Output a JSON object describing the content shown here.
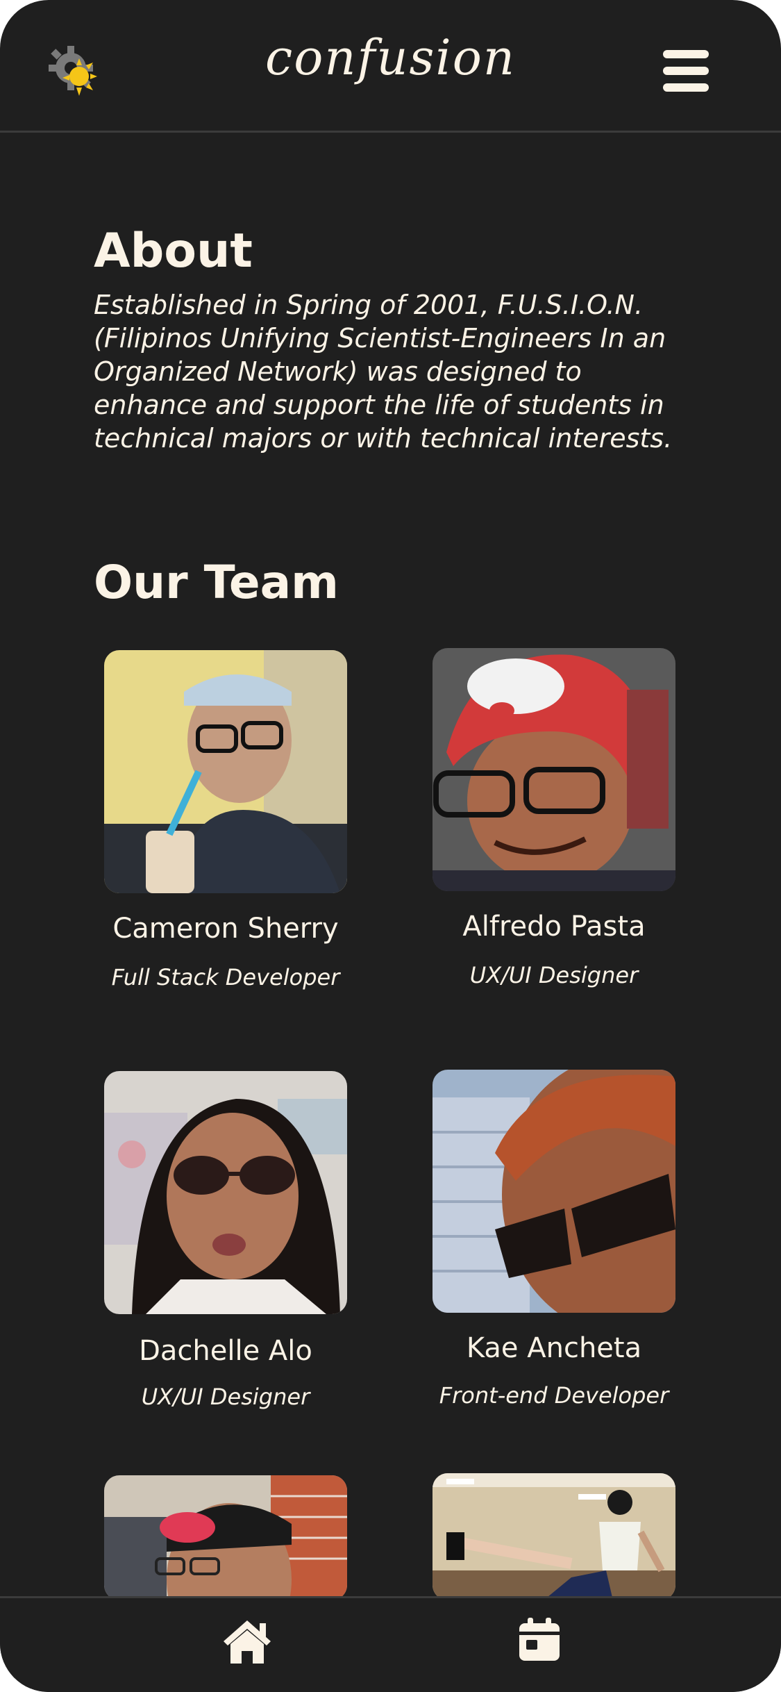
{
  "header": {
    "brand": "confusion",
    "logo_icon": "sun-gear-icon",
    "menu_icon": "hamburger-menu-icon"
  },
  "about": {
    "title": "About",
    "text": "Established in Spring of 2001, F.U.S.I.O.N. (Filipinos Unifying Scientist-Engineers In an Organized Network) was designed to enhance and support the life of students in technical majors or with technical interests."
  },
  "team": {
    "title": "Our Team",
    "members": [
      {
        "name": "Cameron Sherry",
        "role": "Full Stack Developer"
      },
      {
        "name": "Alfredo Pasta",
        "role": "UX/UI Designer"
      },
      {
        "name": "Dachelle Alo",
        "role": "UX/UI Designer"
      },
      {
        "name": "Kae Ancheta",
        "role": "Front-end Developer"
      }
    ]
  },
  "nav": {
    "home_icon": "home-icon",
    "calendar_icon": "calendar-icon"
  },
  "colors": {
    "background": "#1f1f1f",
    "text": "#fbf3e6",
    "divider": "#3b3b3b",
    "logo_yellow": "#f5c518",
    "logo_gray": "#7a7a7a"
  }
}
